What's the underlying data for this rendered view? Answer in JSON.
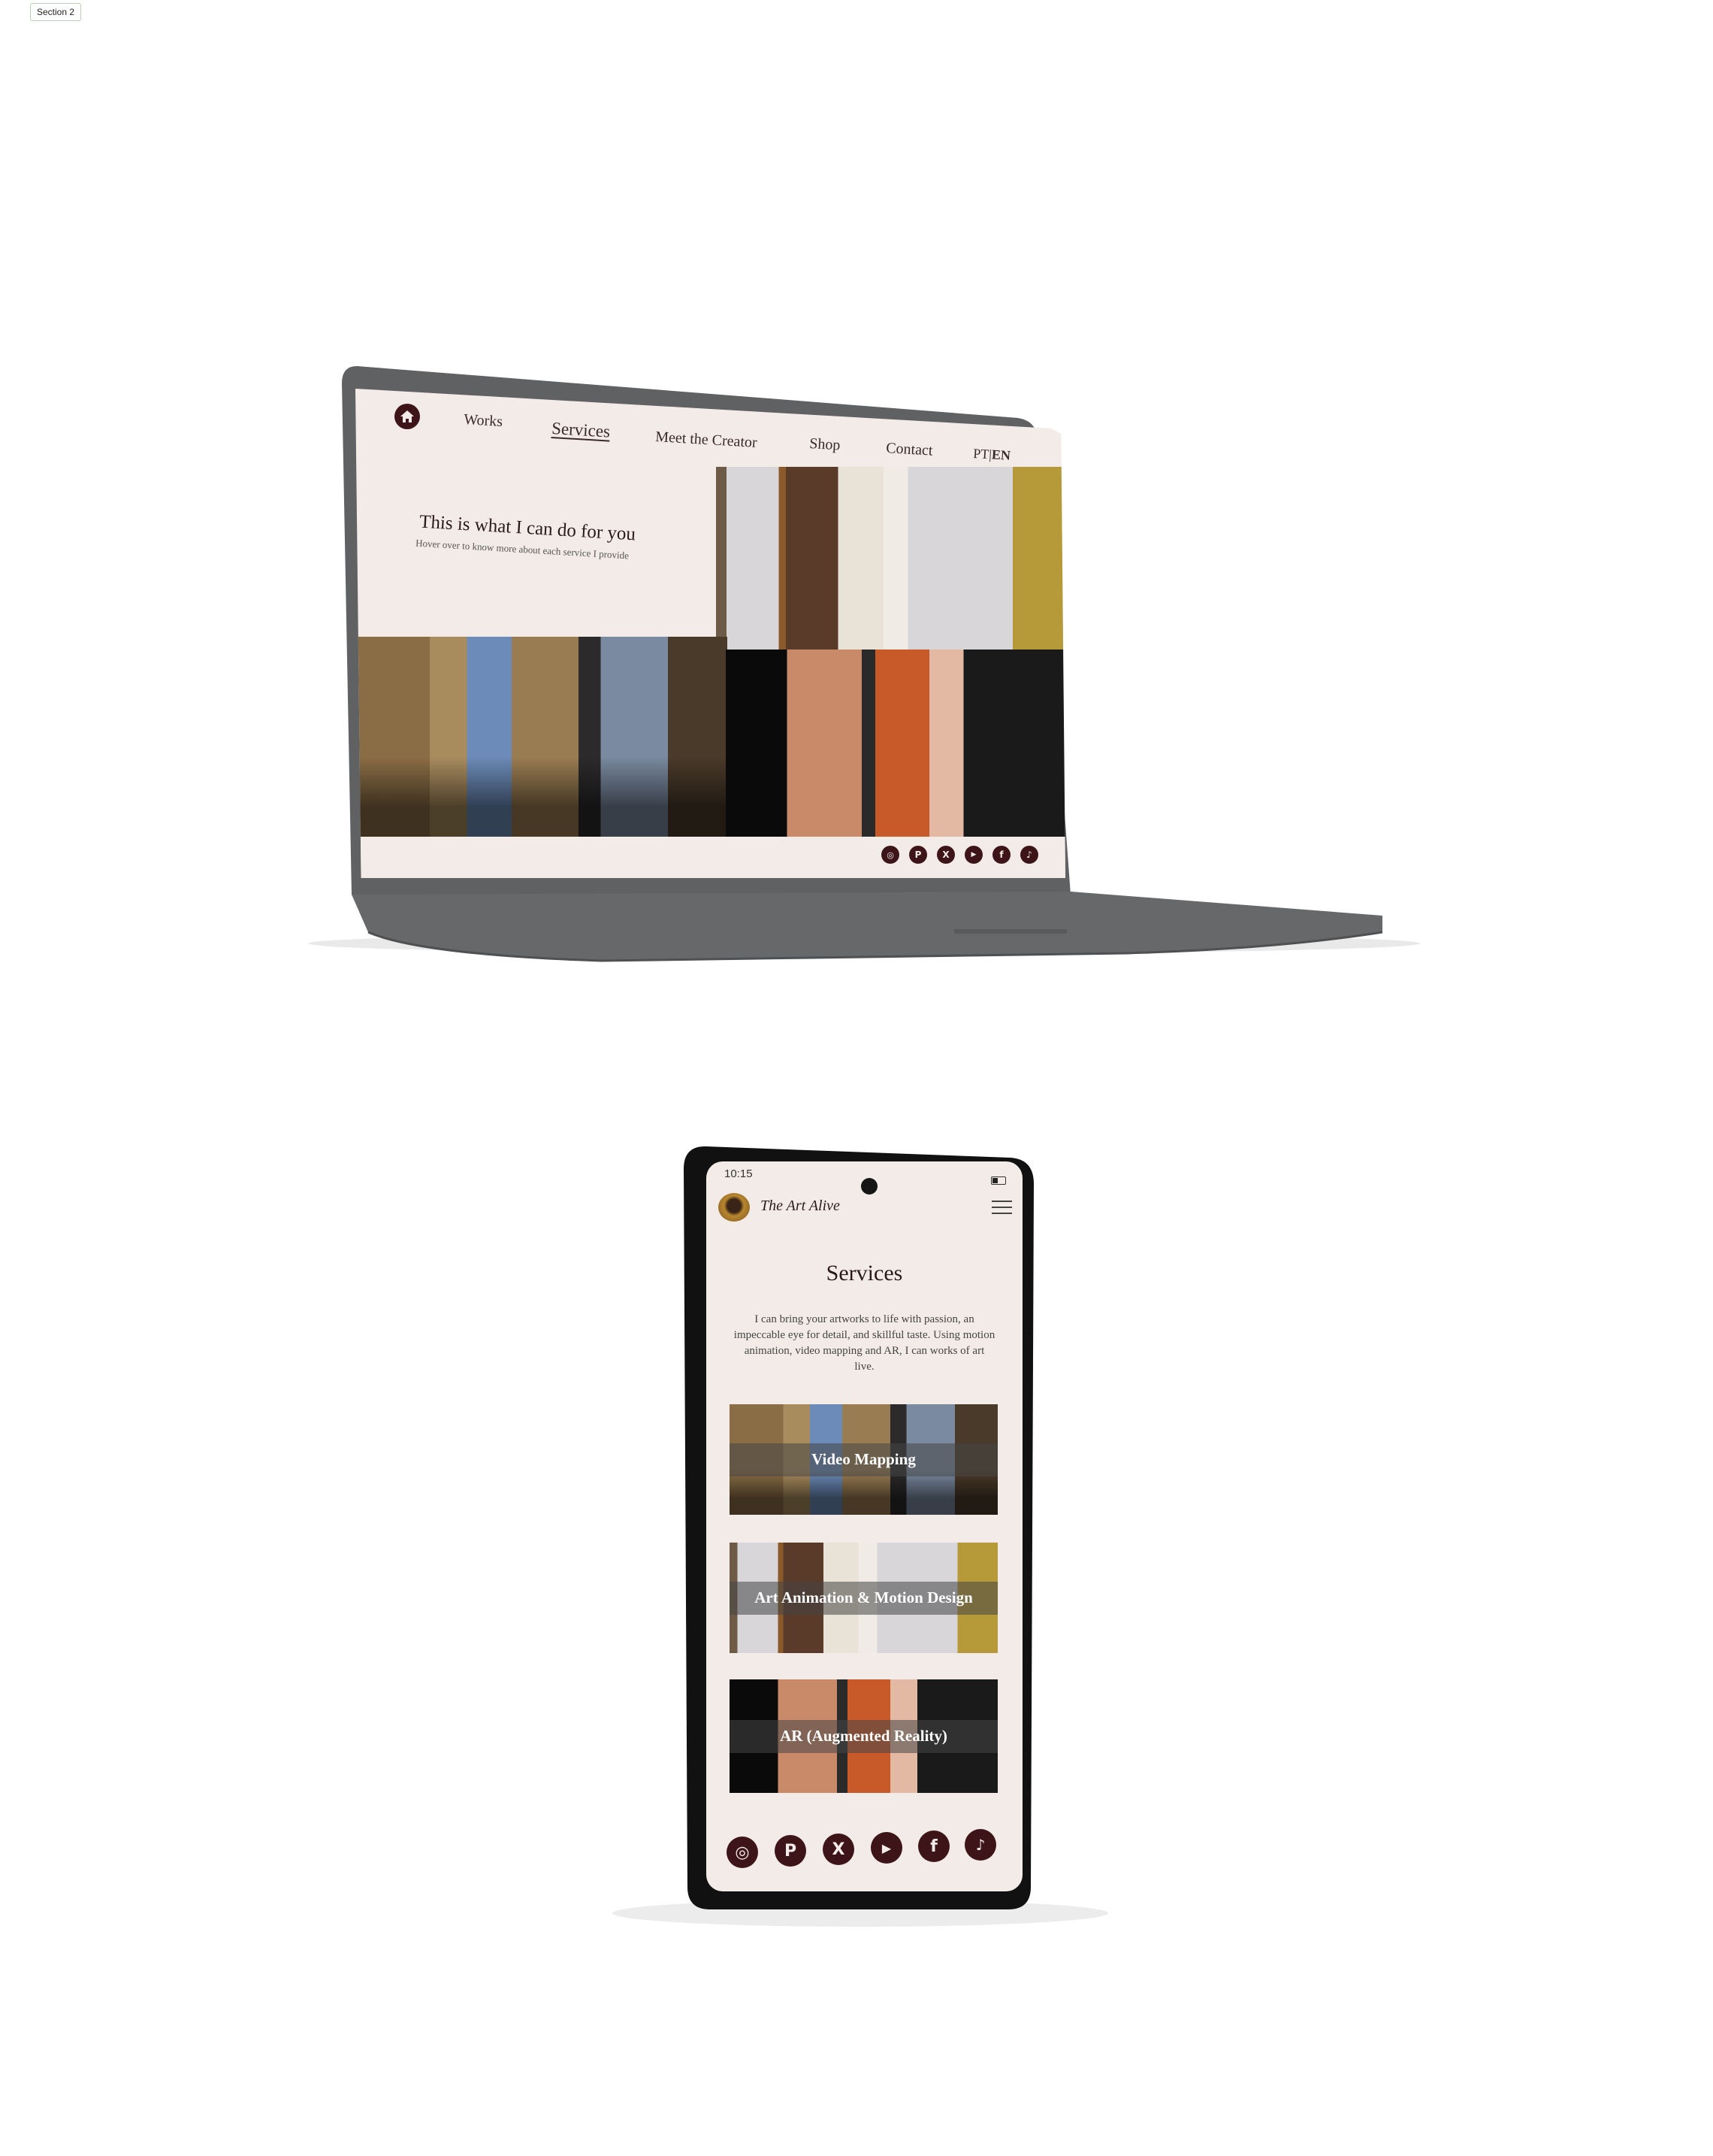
{
  "section_label": "Section 2",
  "colors": {
    "brand_dark": "#3d1518",
    "page_bg": "#f3ebe7",
    "laptop_body": "#5f6163",
    "phone_body": "#111111"
  },
  "laptop": {
    "home_icon": "home-icon",
    "nav": [
      {
        "label": "Works",
        "active": false
      },
      {
        "label": "Services",
        "active": true
      },
      {
        "label": "Meet the Creator",
        "active": false
      },
      {
        "label": "Shop",
        "active": false
      },
      {
        "label": "Contact",
        "active": false
      }
    ],
    "language": {
      "pt": "PT",
      "separator": "|",
      "en": "EN"
    },
    "hero": {
      "title": "This is what I can do for you",
      "subtitle": "Hover over to know more about each service I provide"
    },
    "social_icons": [
      "instagram-icon",
      "pinterest-icon",
      "x-icon",
      "youtube-icon",
      "facebook-icon",
      "tiktok-icon"
    ]
  },
  "phone": {
    "status_time": "10:15",
    "brand": "The Art Alive",
    "title": "Services",
    "description": "I can bring your artworks to life with passion, an impeccable eye for detail, and skillful taste. Using motion animation, video mapping and AR, I can works of art live.",
    "services": [
      {
        "label": "Video Mapping"
      },
      {
        "label": "Art Animation & Motion Design"
      },
      {
        "label": "AR (Augmented Reality)"
      }
    ],
    "social_icons": [
      "instagram-icon",
      "pinterest-icon",
      "x-icon",
      "youtube-icon",
      "facebook-icon",
      "tiktok-icon"
    ]
  }
}
